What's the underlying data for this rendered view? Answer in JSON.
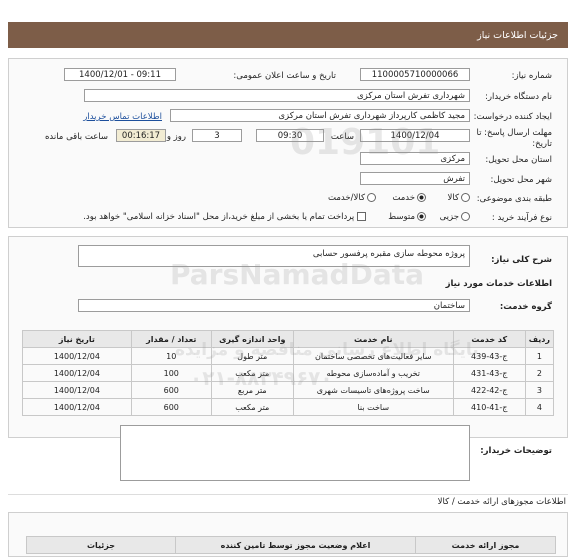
{
  "header": {
    "title": "جزئیات اطلاعات نیاز"
  },
  "form": {
    "need_number_label": "شماره نیاز:",
    "need_number": "1100005710000066",
    "announce_label": "تاریخ و ساعت اعلان عمومی:",
    "announce_value": "1400/12/01 - 09:11",
    "buyer_org_label": "نام دستگاه خریدار:",
    "buyer_org": "شهرداری تفرش استان مرکزی",
    "creator_label": "ایجاد کننده درخواست:",
    "creator": "مجید کاظمی کارپرداز شهرداری تفرش استان مرکزی",
    "contact_link": "اطلاعات تماس خریدار",
    "deadline_label_1": "مهلت ارسال پاسخ: تا",
    "deadline_label_2": "تاریخ:",
    "deadline_date": "1400/12/04",
    "time_label": "ساعت",
    "deadline_time": "09:30",
    "days": "3",
    "days_label": "روز و",
    "remaining": "00:16:17",
    "remaining_label": "ساعت باقی مانده",
    "province_label": "استان محل تحویل:",
    "province": "مرکزی",
    "city_label": "شهر محل تحویل:",
    "city": "تفرش",
    "category_label": "طبقه بندی موضوعی:",
    "cat_goods": "کالا",
    "cat_service": "خدمت",
    "cat_both": "کالا/خدمت",
    "process_label": "نوع فرآیند خرید :",
    "proc_small": "جزیی",
    "proc_medium": "متوسط",
    "proc_note": "پرداخت تمام یا بخشی از مبلغ خرید،از محل \"اسناد خزانه اسلامی\" خواهد بود."
  },
  "summary": {
    "label": "شرح کلی نیاز:",
    "value": "پروژه محوطه سازی مقبره پرفسور حسابی"
  },
  "services": {
    "title": "اطلاعات خدمات مورد نیاز",
    "group_label": "گروه خدمت:",
    "group_value": "ساختمان"
  },
  "table": {
    "headers": [
      "ردیف",
      "کد خدمت",
      "نام خدمت",
      "واحد اندازه گیری",
      "تعداد / مقدار",
      "تاریخ نیاز"
    ],
    "rows": [
      [
        "1",
        "ج-43-439",
        "سایر فعالیت‌های تخصصی ساختمان",
        "متر طول",
        "10",
        "1400/12/04"
      ],
      [
        "2",
        "ج-43-431",
        "تخریب و آماده‌سازی محوطه",
        "متر مکعب",
        "100",
        "1400/12/04"
      ],
      [
        "3",
        "ج-42-422",
        "ساخت پروژه‌های تاسیسات شهری",
        "متر مربع",
        "600",
        "1400/12/04"
      ],
      [
        "4",
        "ج-41-410",
        "ساخت بنا",
        "متر مکعب",
        "600",
        "1400/12/04"
      ]
    ]
  },
  "buyer_notes": {
    "label": "توضیحات خریدار:"
  },
  "attachments": {
    "title": "اطلاعات مجوزهای ارائه خدمت / کالا",
    "headers": [
      "مجوز ارائه خدمت",
      "اعلام وضعیت مجوز توسط تامین کننده",
      "جزئیات"
    ]
  },
  "watermark": {
    "top": "ParsNamadData",
    "line1": "پایگاه اطلاع رسانی مناقصه و مزایده",
    "line2": "۰۲۱-۸۸۳۴۹۶۷۰",
    "code": "019101"
  },
  "colors": {
    "header": "#7d5d48",
    "link": "#1d4f9c",
    "remaining_bg": "#f2ecd3"
  }
}
